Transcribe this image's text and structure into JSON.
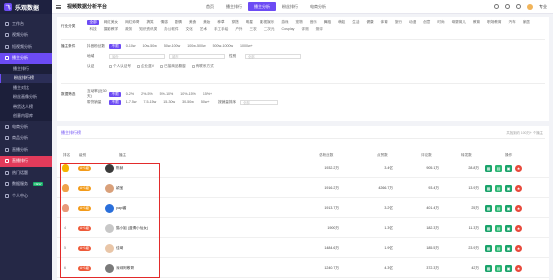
{
  "app": {
    "logo_mark": "飞",
    "logo_text": "乐观数据",
    "title": "视频数据分析平台"
  },
  "sidebar": {
    "items": [
      {
        "label": "工作台"
      },
      {
        "label": "视频分析"
      },
      {
        "label": "短视频分析"
      },
      {
        "label": "播主分析"
      }
    ],
    "subs": [
      {
        "label": "播主排行"
      },
      {
        "label": "粉丝排行榜"
      },
      {
        "label": "播主对比"
      },
      {
        "label": "粉丝画像分析"
      },
      {
        "label": "带货达人榜"
      },
      {
        "label": "创意内容库"
      }
    ],
    "more": [
      {
        "label": "电商分析"
      },
      {
        "label": "商品分析"
      },
      {
        "label": "直播分析"
      },
      {
        "label": "直播排行"
      },
      {
        "label": "热门话题"
      },
      {
        "label": "数据服务",
        "badge": "NEW"
      },
      {
        "label": "个人中心"
      }
    ]
  },
  "topbar": {
    "nav": [
      "首页",
      "播主排行",
      "播主分析",
      "粉丝排行",
      "电商分析"
    ],
    "active_index": 2,
    "user": "专业"
  },
  "filters": {
    "industry_label": "行业分类",
    "industry": [
      "全部",
      "网红美女",
      "网红帅哥",
      "搞笑",
      "情感",
      "剧情",
      "美食",
      "美妆",
      "种草",
      "穿搭",
      "明星",
      "影视娱乐",
      "游戏",
      "宠物",
      "音乐",
      "舞蹈",
      "萌娃",
      "生活",
      "健康",
      "体育",
      "旅行",
      "动漫",
      "创意",
      "时尚",
      "母婴育儿",
      "教育",
      "职场教育",
      "汽车",
      "家居",
      "科技",
      "摄影教学",
      "政务",
      "知识资讯类",
      "办公软件",
      "文化",
      "艺术",
      "手工手绘",
      "户外",
      "三农",
      "二次元",
      "Cosplay",
      "评测",
      "测评"
    ],
    "base_label": "播主条件",
    "fans_label": "抖音粉丝数",
    "fans": [
      "不限",
      "0-10w",
      "10w-50w",
      "50w-100w",
      "100w-500w",
      "500w-1000w",
      "1000w+"
    ],
    "region_label": "地域",
    "region_placeholder": "省份",
    "city_placeholder": "城市",
    "gender_label": "性别",
    "gender_placeholder": "全部",
    "other_label": "认证",
    "checks": [
      "个人认证号",
      "企业蓝V",
      "已接商品橱窗",
      "有联系方式"
    ],
    "data_label": "数据筛选",
    "ratio_label": "互动率(近30天)",
    "ratio": [
      "不限",
      "0-2%",
      "2%-5%",
      "5%-10%",
      "10%-15%",
      "15%+"
    ],
    "growth_label": "带货销量",
    "growth": [
      "不限",
      "1-7.5w",
      "7.5-15w",
      "15-30w",
      "30-50w",
      "50w+"
    ],
    "sort_label": "按销量排序",
    "sort_placeholder": "全部"
  },
  "table": {
    "heading": "播主排行榜",
    "note": "共找到约 100万+ 个播主",
    "columns": [
      "排名",
      "级别",
      "播主",
      "总粉丝数",
      "点赞数",
      "评论数",
      "转发数",
      "操作"
    ],
    "rows": [
      {
        "rank": "1",
        "level": "A+1级",
        "name": "陈赫",
        "fans": "1932.2万",
        "likes": "3.4亿",
        "comments": "905.1万",
        "shares": "28.8万"
      },
      {
        "rank": "2",
        "level": "A+1级",
        "name": "颖宝",
        "fans": "1916.2万",
        "likes": "4266.7万",
        "comments": "93.4万",
        "shares": "13.9万"
      },
      {
        "rank": "3",
        "level": "A+1级",
        "name": "papi酱",
        "fans": "1913.7万",
        "likes": "3.2亿",
        "comments": "401.4万",
        "shares": "25万"
      },
      {
        "rank": "4",
        "level": "A+1级",
        "name": "猫小姐 (蓝倩小仙女)",
        "fans": "1900万",
        "likes": "1.3亿",
        "comments": "182.3万",
        "shares": "11.3万"
      },
      {
        "rank": "5",
        "level": "A+1级",
        "name": "佳琦",
        "fans": "1484.6万",
        "likes": "1.9亿",
        "comments": "185.5万",
        "shares": "23.9万"
      },
      {
        "rank": "6",
        "level": "A+1级",
        "name": "深圳阿敬哥",
        "fans": "1240.7万",
        "likes": "4.3亿",
        "comments": "372.3万",
        "shares": "42万"
      }
    ]
  },
  "colors": {
    "accent": "#6c4bf4",
    "sidebar": "#252846",
    "danger": "#e84a3c",
    "success": "#1aa36b"
  }
}
